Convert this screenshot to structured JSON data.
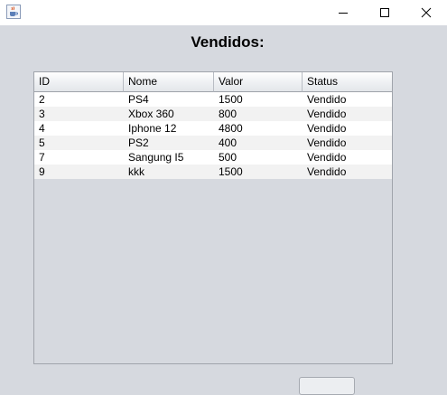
{
  "window": {
    "icon": "java-cup-icon"
  },
  "heading": "Vendidos:",
  "table": {
    "columns": [
      "ID",
      "Nome",
      "Valor",
      "Status"
    ],
    "rows": [
      [
        "2",
        "PS4",
        "1500",
        "Vendido"
      ],
      [
        "3",
        "Xbox 360",
        "800",
        "Vendido"
      ],
      [
        "4",
        "Iphone 12",
        "4800",
        "Vendido"
      ],
      [
        "5",
        "PS2",
        "400",
        "Vendido"
      ],
      [
        "7",
        "Sangung I5",
        "500",
        "Vendido"
      ],
      [
        "9",
        "kkk",
        "1500",
        "Vendido"
      ]
    ]
  },
  "colors": {
    "window_bg": "#d6d9df",
    "titlebar_bg": "#ffffff"
  }
}
